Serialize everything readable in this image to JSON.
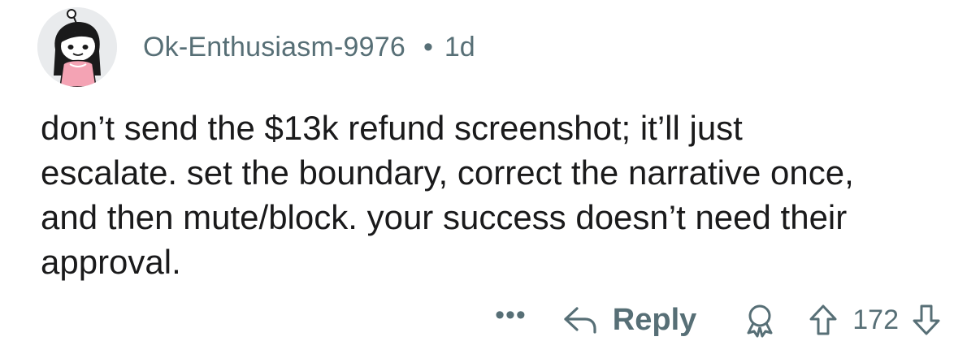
{
  "comment": {
    "author": "Ok-Enthusiasm-9976",
    "separator": "•",
    "age": "1d",
    "body": "don’t send the $13k refund screenshot; it’ll just\nescalate. set the boundary, correct the narrative once,\nand then mute/block. your success doesn’t need their\napproval.",
    "more_label": "•••",
    "reply_label": "Reply",
    "vote_count": "172"
  },
  "icons": {
    "avatar": "user-avatar",
    "reply": "reply-arrow-icon",
    "award": "award-icon",
    "upvote": "upvote-icon",
    "downvote": "downvote-icon"
  },
  "colors": {
    "meta_text": "#576f76",
    "body_text": "#1a1a1b",
    "background": "#ffffff"
  }
}
